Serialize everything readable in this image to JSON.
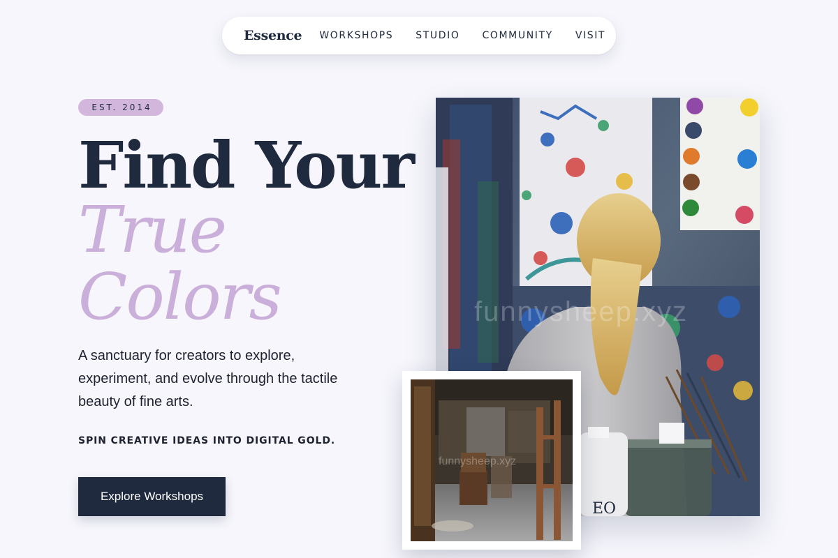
{
  "nav": {
    "brand": "Essence",
    "links": [
      "WORKSHOPS",
      "STUDIO",
      "COMMUNITY",
      "VISIT"
    ]
  },
  "hero": {
    "badge": "EST. 2014",
    "title_line1": "Find Your",
    "title_line2": "True",
    "title_line3": "Colors",
    "description": "A sanctuary for creators to explore, experiment, and evolve through the tactile beauty of fine arts.",
    "tagline": "SPIN CREATIVE IDEAS INTO DIGITAL GOLD.",
    "cta_label": "Explore Workshops"
  },
  "images": {
    "main_watermark": "funnysheep.xyz",
    "inset_watermark": "funnysheep.xyz",
    "jar_label": "EO"
  },
  "colors": {
    "background": "#f6f6fc",
    "navy": "#1f2a3f",
    "lavender": "#c9afd9",
    "badge": "#d3b6dc"
  }
}
